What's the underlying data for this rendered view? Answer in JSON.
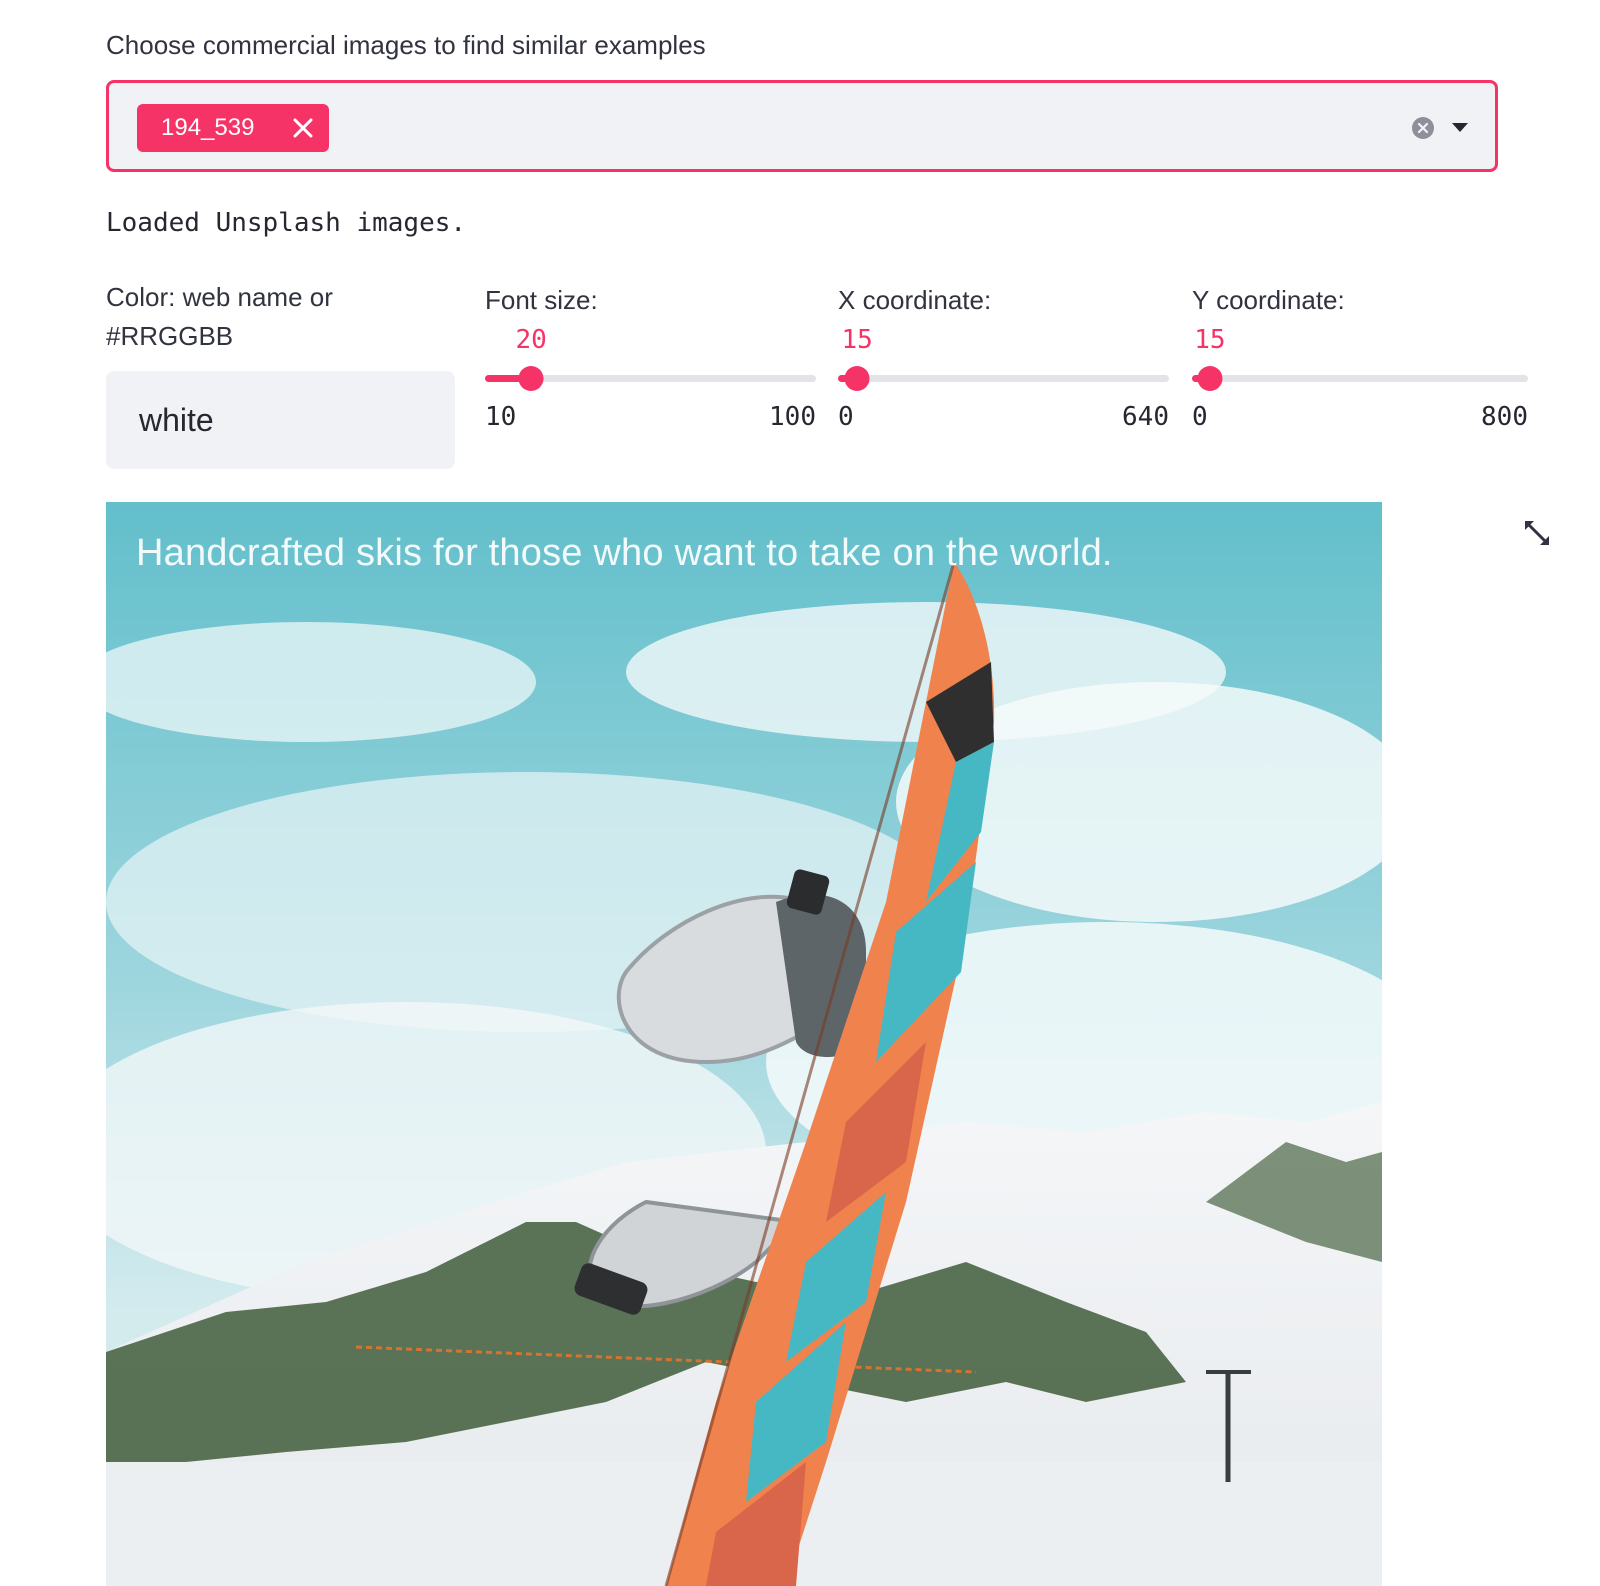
{
  "multiselect": {
    "label": "Choose commercial images to find similar examples",
    "selected_chip": "194_539",
    "chip_close_icon": "close-icon",
    "clear_icon": "clear-circle-icon",
    "dropdown_icon": "caret-down-icon",
    "accent_color": "#f63366"
  },
  "status": "Loaded Unsplash images.",
  "color_field": {
    "label_line1": "Color: web name or",
    "label_line2": "#RRGGBB",
    "value": "white"
  },
  "sliders": [
    {
      "label": "Font size:",
      "value": 20,
      "value_text": "20",
      "min": 10,
      "max": 100,
      "min_text": "10",
      "max_text": "100"
    },
    {
      "label": "X coordinate:",
      "value": 15,
      "value_text": "15",
      "min": 0,
      "max": 640,
      "min_text": "0",
      "max_text": "640"
    },
    {
      "label": "Y coordinate:",
      "value": 15,
      "value_text": "15",
      "min": 0,
      "max": 800,
      "min_text": "0",
      "max_text": "800"
    }
  ],
  "image": {
    "overlay_text": "Handcrafted skis for those who want to take on the world.",
    "fullscreen_icon": "expand-icon"
  }
}
